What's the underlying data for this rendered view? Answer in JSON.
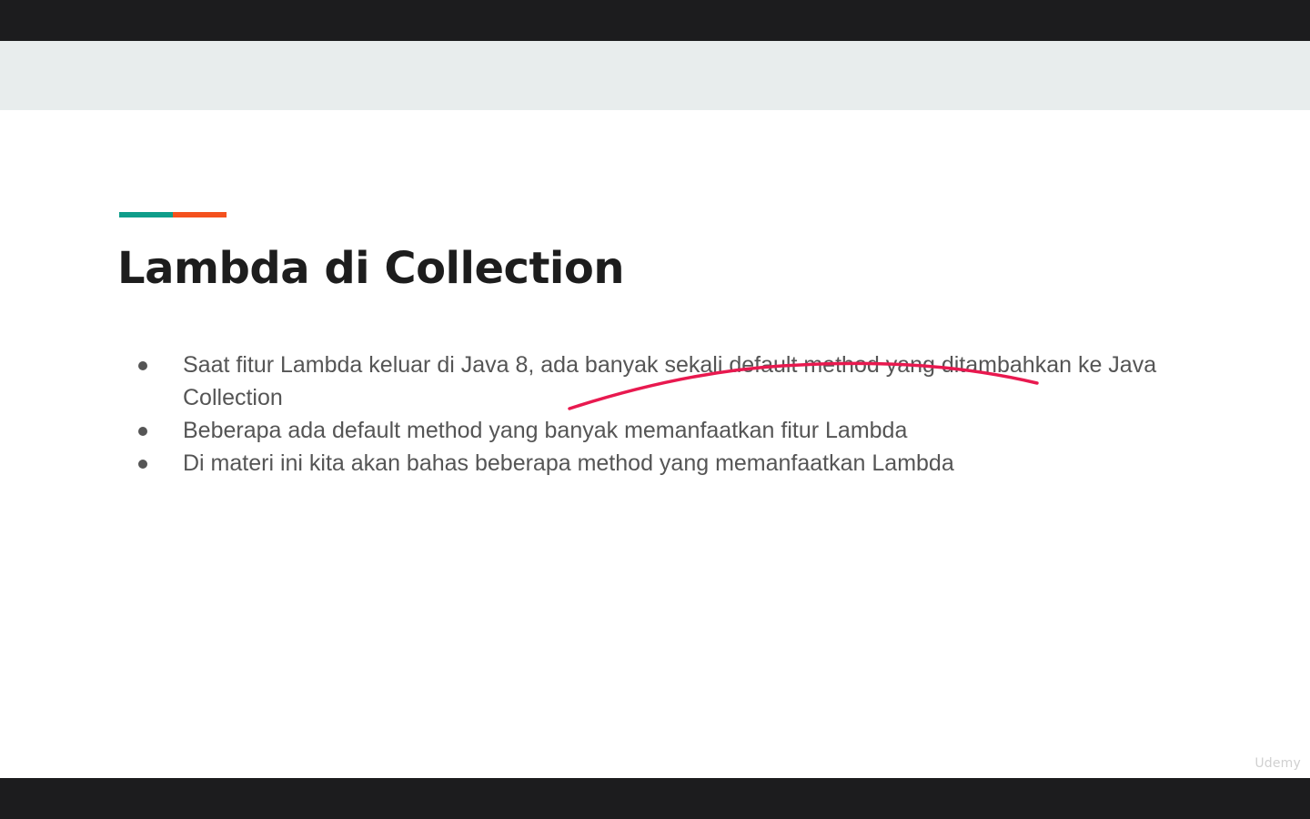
{
  "slide": {
    "title": "Lambda di Collection",
    "accent_colors": [
      "#0f9d8a",
      "#f4511e"
    ],
    "bullets": [
      "Saat fitur Lambda keluar di Java 8, ada banyak sekali default method yang ditambahkan ke Java Collection",
      "Beberapa ada default method yang banyak memanfaatkan fitur Lambda",
      "Di materi ini kita akan bahas beberapa method yang memanfaatkan Lambda"
    ],
    "annotation_color": "#e8194f"
  },
  "player": {
    "watermark": "Udemy"
  }
}
